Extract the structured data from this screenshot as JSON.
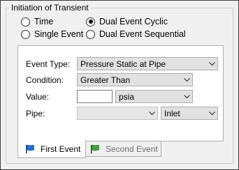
{
  "group": {
    "title": "Initiation of Transient"
  },
  "initiation_options": [
    {
      "label": "Time",
      "checked": false
    },
    {
      "label": "Dual Event Cyclic",
      "checked": true
    },
    {
      "label": "Single Event",
      "checked": false
    },
    {
      "label": "Dual Event Sequential",
      "checked": false
    }
  ],
  "form": {
    "event_type": {
      "label": "Event Type:",
      "value": "Pressure Static at Pipe"
    },
    "condition": {
      "label": "Condition:",
      "value": "Greater Than"
    },
    "value": {
      "label": "Value:",
      "input": "",
      "unit": "psia"
    },
    "pipe": {
      "label": "Pipe:",
      "value": "",
      "location": "Inlet"
    }
  },
  "tabs": [
    {
      "label": "First Event",
      "active": true,
      "icon": "blue-flag-icon",
      "color": "#1e6fd9"
    },
    {
      "label": "Second Event",
      "active": false,
      "icon": "green-flag-icon",
      "color": "#3aa635"
    }
  ]
}
